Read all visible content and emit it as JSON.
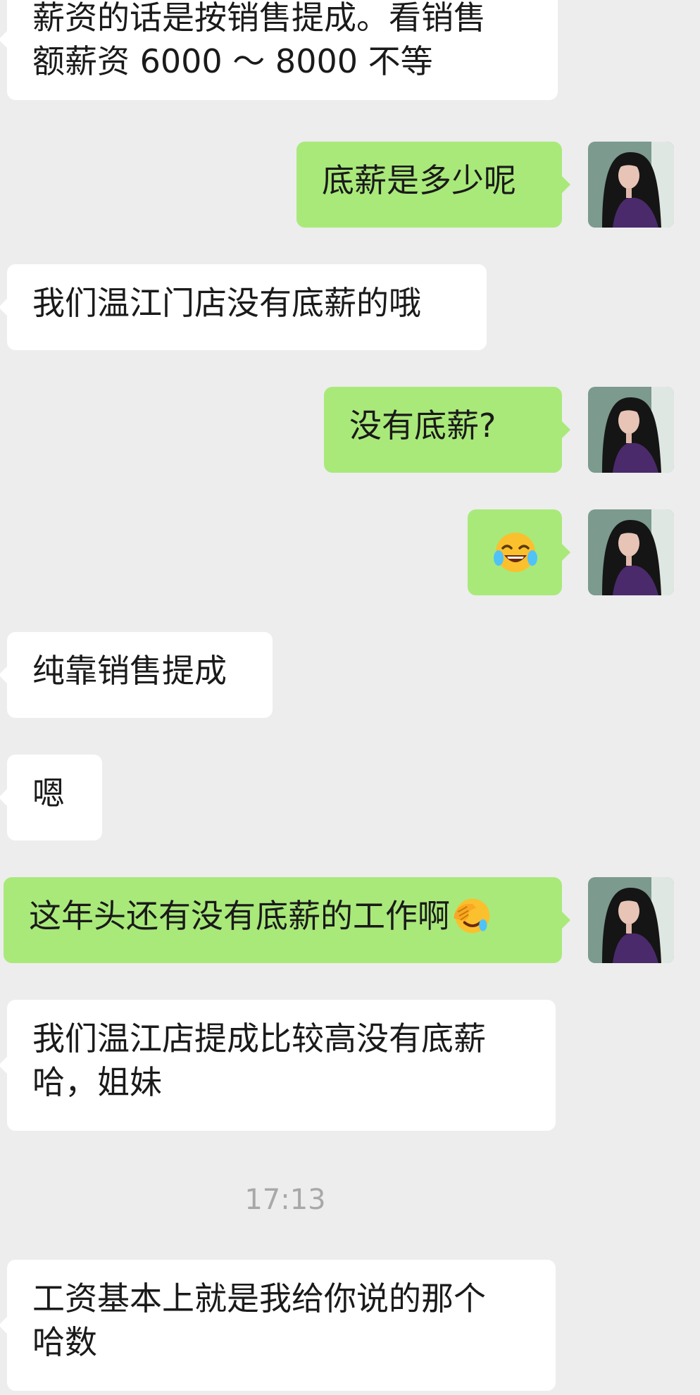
{
  "messages": [
    {
      "side": "left",
      "text": "薪资的话是按销售提成。看销售\n额薪资 6000 ～ 8000 不等"
    },
    {
      "side": "right",
      "text": "底薪是多少呢"
    },
    {
      "side": "left",
      "text": "我们温江门店没有底薪的哦"
    },
    {
      "side": "right",
      "text": "没有底薪?"
    },
    {
      "side": "right",
      "emoji": "face-with-tears-of-joy"
    },
    {
      "side": "left",
      "text": "纯靠销售提成"
    },
    {
      "side": "left",
      "text": "嗯"
    },
    {
      "side": "right",
      "text": "这年头还有没有底薪的工作啊",
      "emoji": "face-palm"
    },
    {
      "side": "left",
      "text": "我们温江店提成比较高没有底薪\n哈，姐妹"
    },
    {
      "side": "left",
      "text": "工资基本上就是我给你说的那个\n哈数"
    }
  ],
  "timestamp": "17:13",
  "colors": {
    "background": "#EDEDED",
    "sent_bubble": "#A9E97A",
    "received_bubble": "#FFFFFF",
    "timestamp_text": "#A8A8A8"
  }
}
